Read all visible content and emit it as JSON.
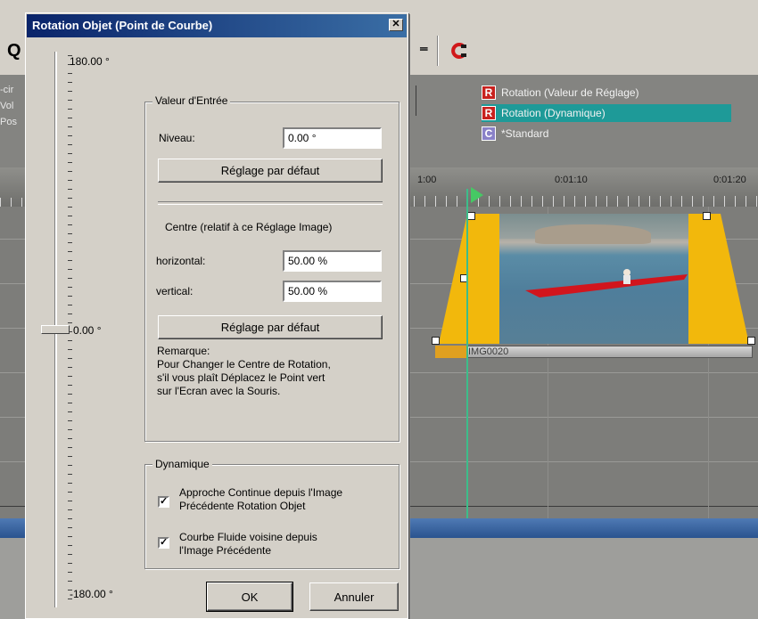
{
  "dialog": {
    "title": "Rotation Objet (Point de Courbe)",
    "close_glyph": "✕",
    "slider": {
      "max_label": "180.00 °",
      "current_label": "0.00 °",
      "min_label": "-180.00 °",
      "value": 0.0
    },
    "input_group": {
      "title": "Valeur d'Entrée",
      "level_label": "Niveau:",
      "level_value": "0.00 °",
      "default_button_1": "Réglage par défaut",
      "centre_heading": "Centre (relatif à ce Réglage Image)",
      "horizontal_label": "horizontal:",
      "horizontal_value": "50.00 %",
      "vertical_label": "vertical:",
      "vertical_value": "50.00 %",
      "default_button_2": "Réglage par défaut",
      "note_title": "Remarque:",
      "note_line1": "Pour Changer le Centre de Rotation,",
      "note_line2": "s'il vous plaît Déplacez le Point vert",
      "note_line3": "sur l'Ecran avec la Souris."
    },
    "dynamic_group": {
      "title": "Dynamique",
      "check1_line1": "Approche Continue depuis l'Image",
      "check1_line2": "Précédente Rotation Objet",
      "check1_checked": true,
      "check2_line1": "Courbe Fluide voisine depuis",
      "check2_line2": "l'Image Précédente",
      "check2_checked": true
    },
    "ok_button": "OK",
    "cancel_button": "Annuler"
  },
  "background": {
    "tracks": [
      {
        "badge": "R",
        "label": "Rotation (Valeur de Réglage)",
        "selected": false
      },
      {
        "badge": "R",
        "label": "Rotation (Dynamique)",
        "selected": true
      },
      {
        "badge": "C",
        "label": "*Standard",
        "selected": false
      }
    ],
    "left_labels": [
      "-cir",
      "Vol",
      "Pos"
    ],
    "ruler_times": [
      "1:00",
      "0:01:10",
      "0:01:20"
    ],
    "clip_name": "IMG0020",
    "toolbar_fragments": [
      "Q",
      "⁼",
      "ↄ"
    ]
  },
  "colors": {
    "title_gradient_start": "#0a246a",
    "title_gradient_end": "#3a6ea5",
    "selected_track": "#1e9a98",
    "clip_yellow": "#f2b80c",
    "playhead": "#46c864",
    "badge_red": "#c8211e"
  }
}
